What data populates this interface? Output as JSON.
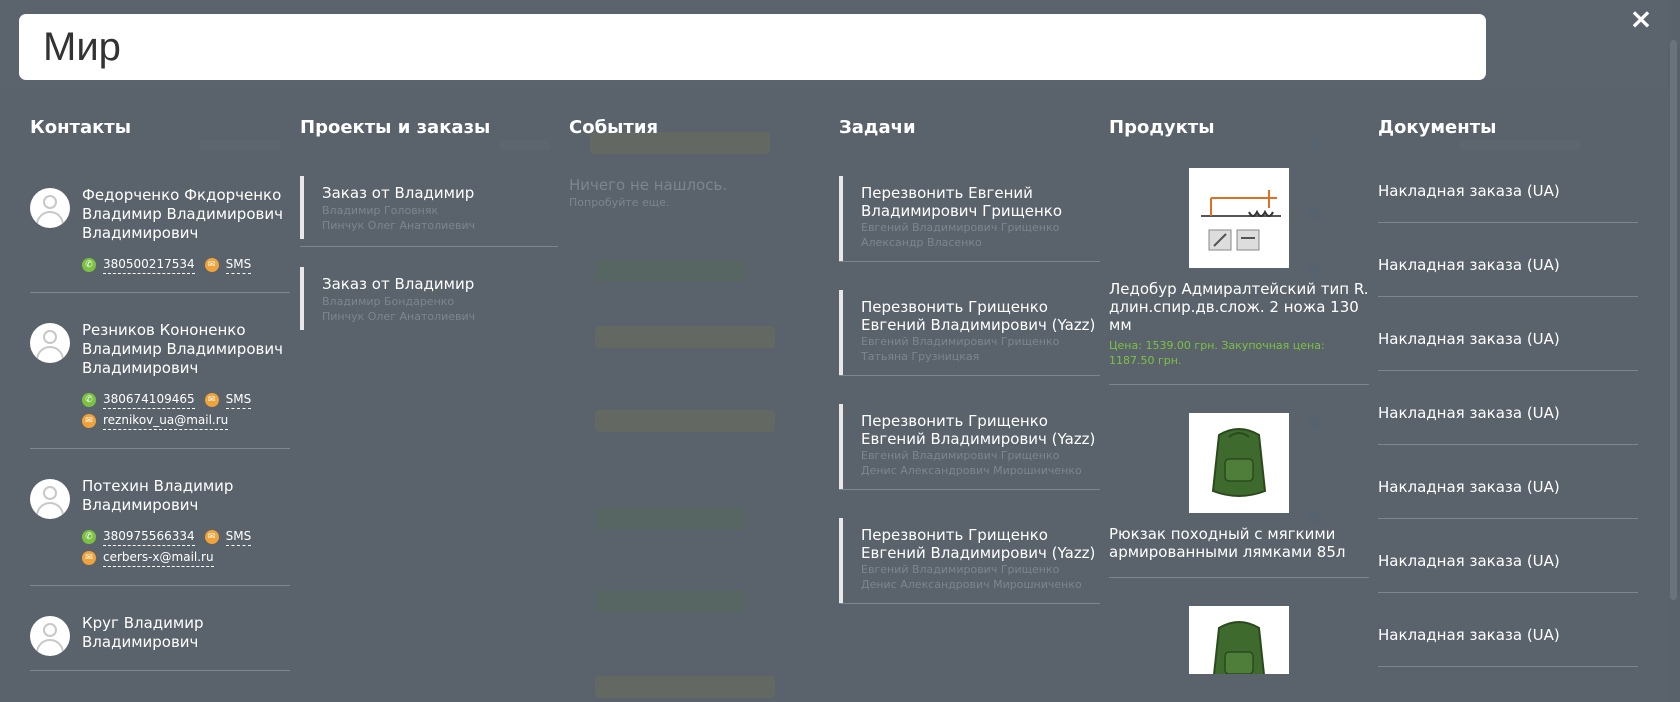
{
  "search": {
    "value": "Мир"
  },
  "close_label": "×",
  "columns": {
    "contacts": {
      "title": "Контакты",
      "items": [
        {
          "name": "Федорченко Фкдорченко Владимир Владимирович Владимирович",
          "phone": "380500217534",
          "sms": "SMS",
          "email": ""
        },
        {
          "name": "Резников Кононенко Владимир Владимирович Владимирович",
          "phone": "380674109465",
          "sms": "SMS",
          "email": "reznikov_ua@mail.ru"
        },
        {
          "name": "Потехин Владимир Владимирович",
          "phone": "380975566334",
          "sms": "SMS",
          "email": "cerbers-x@mail.ru"
        },
        {
          "name": "Круг Владимир Владимирович",
          "phone": "",
          "sms": "",
          "email": ""
        }
      ]
    },
    "projects": {
      "title": "Проекты и заказы",
      "items": [
        {
          "title": "Заказ от Владимир",
          "sub1": "Владимир Головняк",
          "sub2": "Пинчук Олег Анатолиевич"
        },
        {
          "title": "Заказ от Владимир",
          "sub1": "Владимир Бондаренко",
          "sub2": "Пинчук Олег Анатолиевич"
        }
      ]
    },
    "events": {
      "title": "События",
      "empty_title": "Ничего не нашлось.",
      "empty_sub": "Попробуйте еще."
    },
    "tasks": {
      "title": "Задачи",
      "items": [
        {
          "title": "Перезвонить Евгений Владимирович Грищенко",
          "sub1": "Евгений Владимирович Грищенко",
          "sub2": "Александр Власенко"
        },
        {
          "title": "Перезвонить Грищенко Евгений Владимирович (Yazz)",
          "sub1": "Евгений Владимирович Грищенко",
          "sub2": "Татьяна Грузницкая"
        },
        {
          "title": "Перезвонить Грищенко Евгений Владимирович (Yazz)",
          "sub1": "Евгений Владимирович Грищенко",
          "sub2": "Денис Александрович Мирошниченко"
        },
        {
          "title": "Перезвонить Грищенко Евгений Владимирович (Yazz)",
          "sub1": "Евгений Владимирович Грищенко",
          "sub2": "Денис Александрович Мирошниченко"
        }
      ]
    },
    "products": {
      "title": "Продукты",
      "items": [
        {
          "name": "Ледобур Адмиралтейский тип R. длин.спир.дв.слож. 2 ножа 130 мм",
          "price": "Цена: 1539.00 грн. Закупочная цена: 1187.50 грн."
        },
        {
          "name": "Рюкзак походный с мягкими армированными лямками 85л",
          "price": ""
        }
      ]
    },
    "documents": {
      "title": "Документы",
      "items": [
        "Накладная заказа (UA)",
        "Накладная заказа (UA)",
        "Накладная заказа (UA)",
        "Накладная заказа (UA)",
        "Накладная заказа (UA)",
        "Накладная заказа (UA)",
        "Накладная заказа (UA)"
      ]
    }
  },
  "colors": {
    "accent_green": "#7cc242",
    "mail_orange": "#f0a33a",
    "muted_text": "#7d858e",
    "overlay": "#5b636c"
  }
}
